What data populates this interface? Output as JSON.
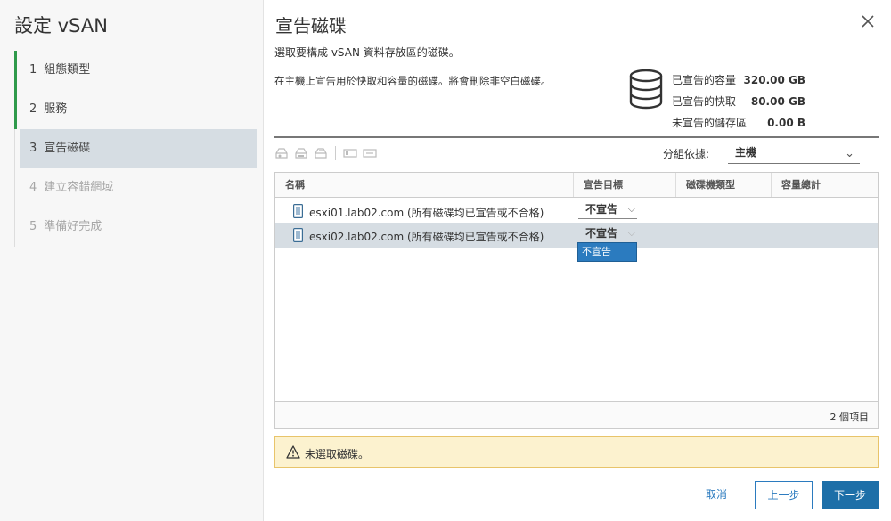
{
  "wizard": {
    "title": "設定 vSAN",
    "steps": [
      {
        "num": "1",
        "label": "組態類型"
      },
      {
        "num": "2",
        "label": "服務"
      },
      {
        "num": "3",
        "label": "宣告磁碟"
      },
      {
        "num": "4",
        "label": "建立容錯網域"
      },
      {
        "num": "5",
        "label": "準備好完成"
      }
    ]
  },
  "main": {
    "title": "宣告磁碟",
    "subtitle": "選取要構成 vSAN 資料存放區的磁碟。",
    "description": "在主機上宣告用於快取和容量的磁碟。將會刪除非空白磁碟。",
    "summary": [
      {
        "label": "已宣告的容量",
        "value": "320.00 GB"
      },
      {
        "label": "已宣告的快取",
        "value": "80.00 GB"
      },
      {
        "label": "未宣告的儲存區",
        "value": "0.00 B"
      }
    ],
    "group_by_label": "分組依據:",
    "group_by_value": "主機",
    "grid": {
      "columns": [
        "名稱",
        "宣告目標",
        "磁碟機類型",
        "容量總計"
      ],
      "rows": [
        {
          "name": "esxi01.lab02.com (所有磁碟均已宣告或不合格)",
          "claim": "不宣告"
        },
        {
          "name": "esxi02.lab02.com (所有磁碟均已宣告或不合格)",
          "claim": "不宣告"
        }
      ],
      "dropdown_option": "不宣告",
      "footer": "2 個項目"
    },
    "warning": "未選取磁碟。",
    "buttons": {
      "cancel": "取消",
      "back": "上一步",
      "next": "下一步"
    }
  },
  "colors": {
    "accent": "#1d6fa8",
    "done_step": "#2f9a4b",
    "selected_row": "#d6dde3",
    "warning_bg": "#fcf2cf"
  }
}
